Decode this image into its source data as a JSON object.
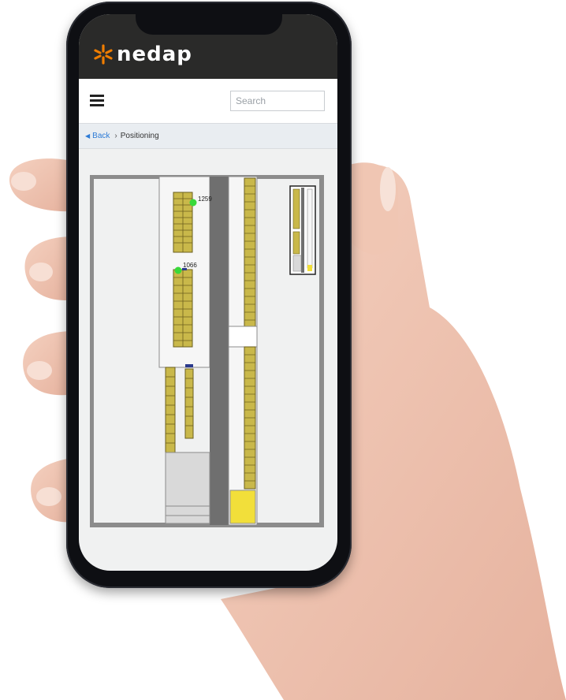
{
  "app": {
    "brand": "nedap",
    "brand_color": "#f07d00"
  },
  "topbar": {
    "menu_icon": "hamburger-menu-icon",
    "search_placeholder": "Search"
  },
  "breadcrumb": {
    "back_label": "Back",
    "current": "Positioning"
  },
  "map": {
    "markers": [
      {
        "id": "1259",
        "color": "#39d93a"
      },
      {
        "id": "1066",
        "color": "#39d93a"
      }
    ],
    "colors": {
      "shelf": "#c9b84a",
      "aisle": "#6f6f6f",
      "wall": "#8c8c8c",
      "highlight": "#f2df3a"
    }
  }
}
